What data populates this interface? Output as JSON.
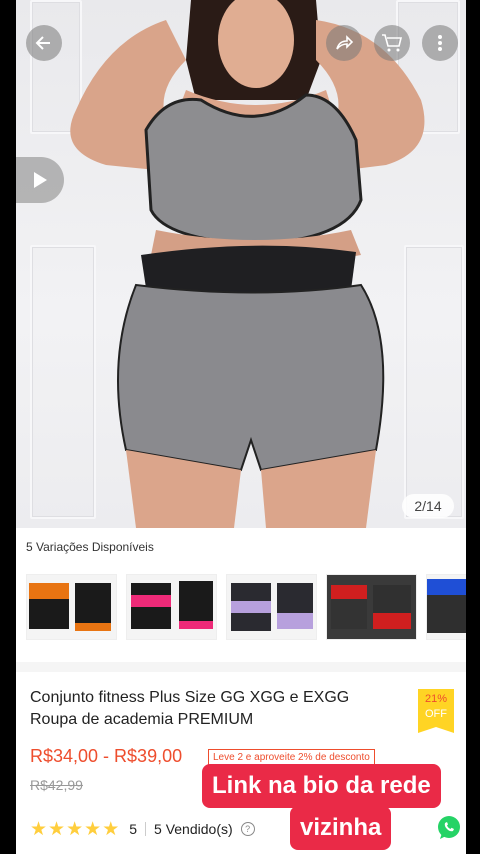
{
  "hero": {
    "image_counter": "2/14"
  },
  "icons": {
    "back": "arrow-left-icon",
    "share": "share-icon",
    "cart": "cart-icon",
    "more": "more-vertical-icon",
    "video": "play-icon",
    "whatsapp": "whatsapp-icon"
  },
  "variations": {
    "title": "5 Variações Disponíveis",
    "items": [
      {
        "color": "orange"
      },
      {
        "color": "pink"
      },
      {
        "color": "lilac"
      },
      {
        "color": "red"
      },
      {
        "color": "blue"
      }
    ]
  },
  "product": {
    "title": "Conjunto fitness Plus Size GG XGG e EXGG Roupa de academia PREMIUM",
    "discount_badge_line1": "21%",
    "discount_badge_line2": "OFF",
    "price_range": "R$34,00 - R$39,00",
    "promo_text": "Leve 2 e aproveite 2% de desconto",
    "old_price": "R$42,99",
    "rating": "5",
    "sold": "5 Vendido(s)",
    "help": "?"
  },
  "overlay": {
    "line1": "Link na bio da rede",
    "line2": "vizinha"
  },
  "colors": {
    "accent": "#ee4d2d",
    "badge": "#ffd424",
    "star": "#ffce3d",
    "overlay": "#ea2a47",
    "whatsapp": "#25d366"
  }
}
